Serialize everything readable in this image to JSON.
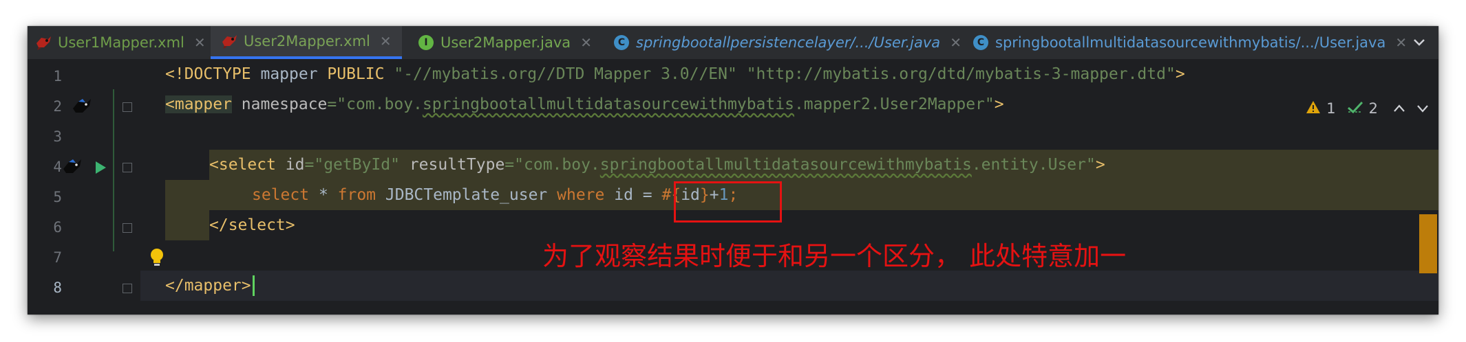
{
  "tabs": [
    {
      "label": "User1Mapper.xml",
      "type": "xml",
      "active": false
    },
    {
      "label": "User2Mapper.xml",
      "type": "xml",
      "active": true
    },
    {
      "label": "User2Mapper.java",
      "type": "java",
      "active": false,
      "icon_letter": "I"
    },
    {
      "label": "springbootallpersistencelayer/.../User.java",
      "type": "cls",
      "active": false,
      "icon_letter": "C"
    },
    {
      "label": "springbootallmultidatasourcewithmybatis/.../User.java",
      "type": "cls",
      "active": false,
      "icon_letter": "C"
    }
  ],
  "close_glyph": "✕",
  "inspections": {
    "warnings": "1",
    "checks": "2"
  },
  "lines": [
    "1",
    "2",
    "3",
    "4",
    "5",
    "6",
    "7",
    "8"
  ],
  "code": {
    "l1_a": "<!DOCTYPE",
    "l1_b": " mapper ",
    "l1_c": "PUBLIC",
    "l1_d": " \"-//mybatis.org//DTD Mapper 3.0//EN\" \"http://mybatis.org/dtd/mybatis-3-mapper.dtd\"",
    "l1_e": ">",
    "l2_tag": "<mapper",
    "l2_attr": " namespace",
    "l2_eq": "=",
    "l2_s1": "\"com.boy.",
    "l2_s2": "springbootallmultidatasourcewithmybatis",
    "l2_s3": ".mapper2.User2Mapper\"",
    "l2_end": ">",
    "l4_tag": "<select",
    "l4_attr1": " id",
    "l4_eq": "=",
    "l4_s1": "\"getById\"",
    "l4_attr2": " resultType",
    "l4_s2a": "\"com.boy.",
    "l4_s2b": "springbootallmultidatasourcewithmybatis",
    "l4_s2c": ".entity.User\"",
    "l4_end": ">",
    "l5_kw1": "select",
    "l5_t1": " * ",
    "l5_kw2": "from",
    "l5_t2": " JDBCTemplate_user ",
    "l5_kw3": "where",
    "l5_t3": " id = ",
    "l5_p1": "#{",
    "l5_p2": "id",
    "l5_p3": "}",
    "l5_t4": "+",
    "l5_n": "1",
    "l5_semi": ";",
    "l6": "</select>",
    "l8": "</mapper>"
  },
  "annotation": "为了观察结果时便于和另一个区分，  此处特意加一",
  "colors": {
    "annotation_red": "#e51212",
    "tab_accent": "#3574f0"
  }
}
